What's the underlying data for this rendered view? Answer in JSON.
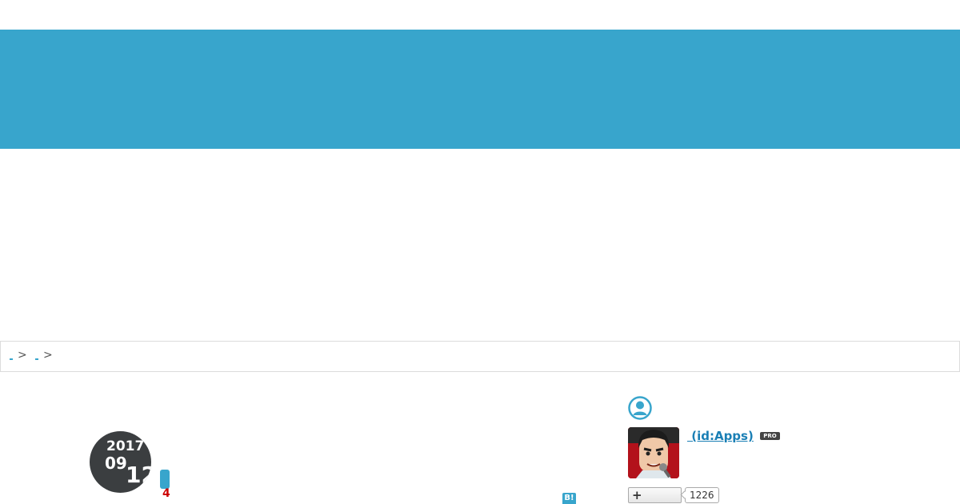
{
  "breadcrumb": {
    "separators": [
      ">",
      ">"
    ]
  },
  "entry": {
    "date_year": "2017",
    "date_month": "09",
    "date_day": "12",
    "comment_count": "4",
    "bookmark_label": "B!"
  },
  "author": {
    "display_name": " (id:Apps)",
    "pro_label": "PRO",
    "follow_label": "+",
    "follower_count": "1226"
  },
  "icons": {
    "profile": "user-circle-icon",
    "avatar": "avatar-image",
    "bookmark": "hatena-bookmark-icon"
  },
  "colors": {
    "accent": "#38a5cc",
    "badge_bg": "#3b3e40",
    "link": "#1a7fb5",
    "count_red": "#cc0000"
  }
}
